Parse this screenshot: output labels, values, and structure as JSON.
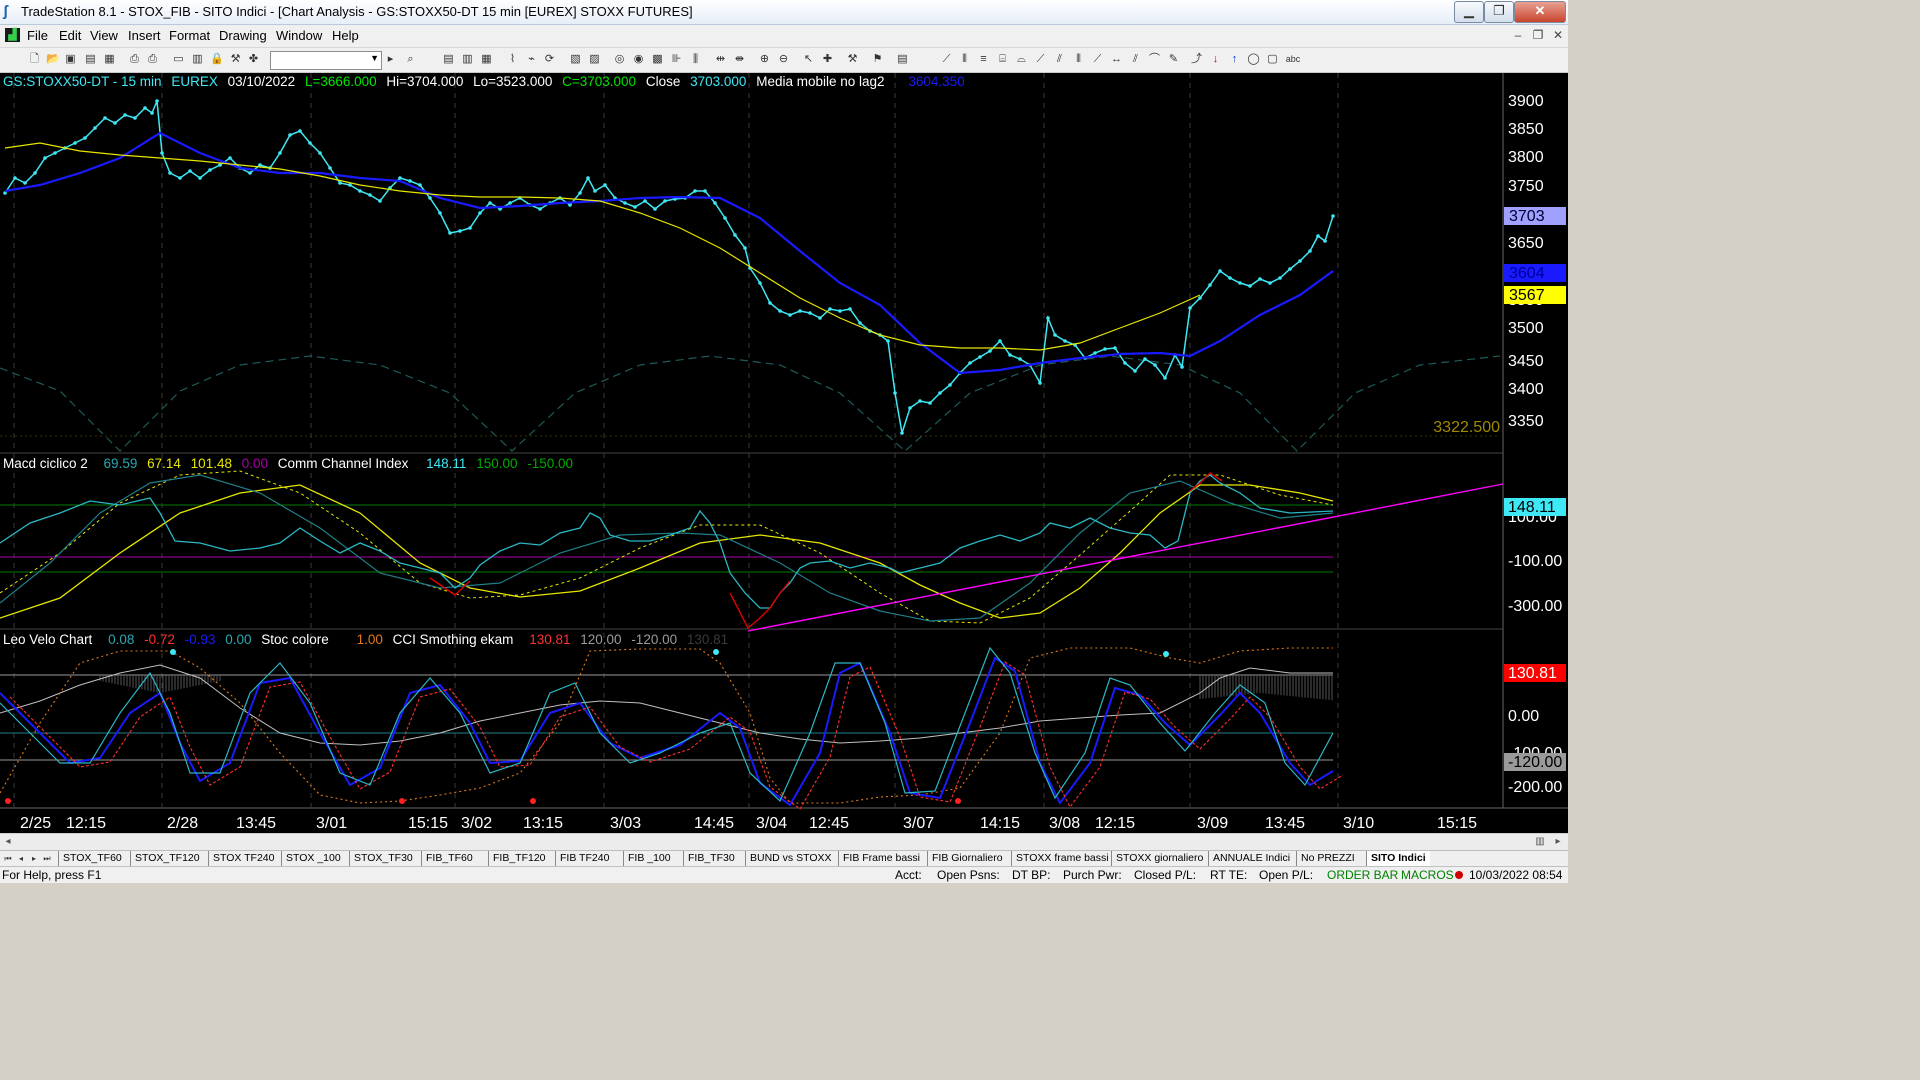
{
  "app": {
    "window_title": "TradeStation 8.1 - STOX_FIB - SITO Indici - [Chart Analysis - GS:STOXX50-DT  15 min  [EUREX] STOXX FUTURES]"
  },
  "menu": [
    "File",
    "Edit",
    "View",
    "Insert",
    "Format",
    "Drawing",
    "Window",
    "Help"
  ],
  "toolbar": {
    "symbol_combo_value": ""
  },
  "colors": {
    "background": "#000000",
    "price": "#3ee8f5",
    "ma_blue": "#1a1aff",
    "ma_yellow": "#e6e600",
    "cycle": "#1e5a5a",
    "cci_line": "#ff00ff",
    "grid": "#2b2b2b",
    "osc_dark": "#0000cc"
  },
  "panel1": {
    "symbol": "GS:STOXX50-DT - 15 min",
    "exchange": "EUREX",
    "date": "03/10/2022",
    "last": "L=3666.000",
    "high": "Hi=3704.000",
    "low": "Lo=3523.000",
    "close_eq": "C=3703.000",
    "close_label": "Close",
    "close_value": "3703.000",
    "ma_label": "Media mobile no lag2",
    "ma_value": "3604.350",
    "axis_ticks": [
      "3900",
      "3850",
      "3800",
      "3750",
      "3650",
      "3600",
      "3550",
      "3500",
      "3450",
      "3400",
      "3350"
    ],
    "price_tags": {
      "last": "3703",
      "ma_blue": "3604",
      "ma_yellow": "3567"
    },
    "cycle_low_label": "3322.500"
  },
  "panel2": {
    "title": "Macd ciclico 2",
    "v1": "69.59",
    "v2": "67.14",
    "v3": "101.48",
    "v4": "0.00",
    "indicator": "Comm Channel Index",
    "cci": "148.11",
    "upper": "150.00",
    "lower": "-150.00",
    "axis_ticks": [
      "100.00",
      "-100.00",
      "-300.00"
    ],
    "tag": "148.11"
  },
  "panel3": {
    "title": "Leo Velo Chart",
    "v1": "0.08",
    "v2": "-0.72",
    "v3": "-0.93",
    "v4": "0.00",
    "stoc": "Stoc colore",
    "stoc_v": "1.00",
    "cci_sm": "CCI Smothing ekam",
    "cci_v": "130.81",
    "up": "120.00",
    "dn": "-120.00",
    "faded": "130.81",
    "axis_ticks": [
      "100.00",
      "0.00",
      "-100.00",
      "-200.00"
    ],
    "tags": {
      "top": "130.81",
      "bottom": "-120.00"
    }
  },
  "time_axis": [
    "2/25",
    "12:15",
    "2/28",
    "13:45",
    "3/01",
    "15:15",
    "3/02",
    "13:15",
    "3/03",
    "14:45",
    "3/04",
    "12:45",
    "3/07",
    "14:15",
    "3/08",
    "12:15",
    "3/09",
    "13:45",
    "3/10",
    "15:15"
  ],
  "tabs": [
    "STOX_TF60",
    "STOX_TF120",
    "STOX TF240",
    "STOX _100",
    "STOX_TF30",
    "FIB_TF60",
    "FIB_TF120",
    "FIB TF240",
    "FIB _100",
    "FIB_TF30",
    "BUND vs STOXX",
    "FIB Frame bassi",
    "FIB Giornaliero",
    "STOXX frame bassi",
    "STOXX giornaliero",
    "ANNUALE Indici",
    "No PREZZI",
    "SITO Indici"
  ],
  "active_tab": "SITO Indici",
  "status": {
    "help": "For Help, press F1",
    "acct": "Acct:",
    "open_psns": "Open Psns:",
    "dt_bp": "DT BP:",
    "purch_pwr": "Purch Pwr:",
    "closed_pl": "Closed P/L:",
    "rt_te": "RT TE:",
    "open_pl": "Open P/L:",
    "order_bar": "ORDER BAR",
    "macros": "MACROS",
    "datetime": "10/03/2022 08:54"
  }
}
